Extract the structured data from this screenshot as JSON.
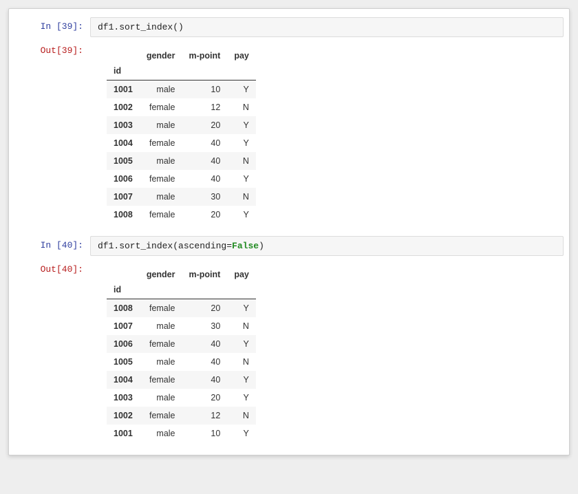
{
  "cells": [
    {
      "in_label": "In  [39]:",
      "out_label": "Out[39]:",
      "code_prefix": "df1.sort_index()",
      "code_kw": "",
      "code_suffix": "",
      "table": {
        "columns": [
          "gender",
          "m-point",
          "pay"
        ],
        "index_name": "id",
        "rows": [
          {
            "id": "1001",
            "gender": "male",
            "mpoint": "10",
            "pay": "Y"
          },
          {
            "id": "1002",
            "gender": "female",
            "mpoint": "12",
            "pay": "N"
          },
          {
            "id": "1003",
            "gender": "male",
            "mpoint": "20",
            "pay": "Y"
          },
          {
            "id": "1004",
            "gender": "female",
            "mpoint": "40",
            "pay": "Y"
          },
          {
            "id": "1005",
            "gender": "male",
            "mpoint": "40",
            "pay": "N"
          },
          {
            "id": "1006",
            "gender": "female",
            "mpoint": "40",
            "pay": "Y"
          },
          {
            "id": "1007",
            "gender": "male",
            "mpoint": "30",
            "pay": "N"
          },
          {
            "id": "1008",
            "gender": "female",
            "mpoint": "20",
            "pay": "Y"
          }
        ]
      }
    },
    {
      "in_label": "In  [40]:",
      "out_label": "Out[40]:",
      "code_prefix": "df1.sort_index(ascending=",
      "code_kw": "False",
      "code_suffix": ")",
      "table": {
        "columns": [
          "gender",
          "m-point",
          "pay"
        ],
        "index_name": "id",
        "rows": [
          {
            "id": "1008",
            "gender": "female",
            "mpoint": "20",
            "pay": "Y"
          },
          {
            "id": "1007",
            "gender": "male",
            "mpoint": "30",
            "pay": "N"
          },
          {
            "id": "1006",
            "gender": "female",
            "mpoint": "40",
            "pay": "Y"
          },
          {
            "id": "1005",
            "gender": "male",
            "mpoint": "40",
            "pay": "N"
          },
          {
            "id": "1004",
            "gender": "female",
            "mpoint": "40",
            "pay": "Y"
          },
          {
            "id": "1003",
            "gender": "male",
            "mpoint": "20",
            "pay": "Y"
          },
          {
            "id": "1002",
            "gender": "female",
            "mpoint": "12",
            "pay": "N"
          },
          {
            "id": "1001",
            "gender": "male",
            "mpoint": "10",
            "pay": "Y"
          }
        ]
      }
    }
  ]
}
